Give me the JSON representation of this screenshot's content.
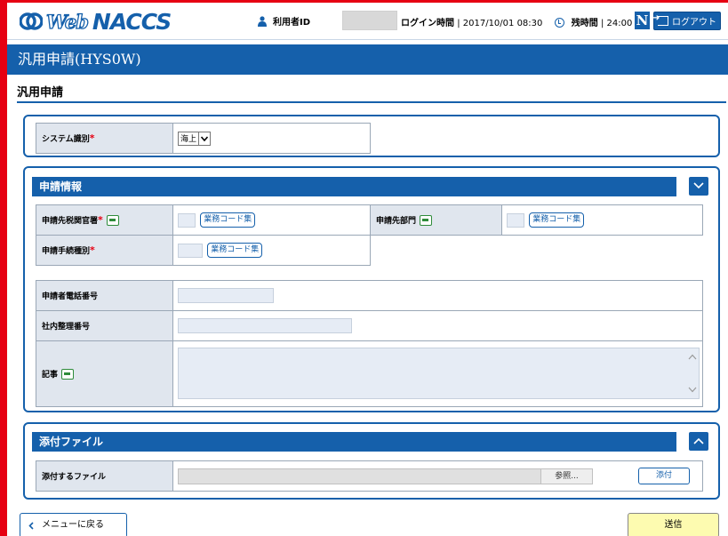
{
  "header": {
    "logo_web": "Web",
    "logo_naccs": "NACCS",
    "user_id_label": "利用者ID",
    "login_time_label": "ログイン時間",
    "login_time_value": "2017/10/01 08:30",
    "remaining_label": "残時間",
    "remaining_value": "24:00",
    "n_label": "N",
    "logout_label": "ログアウト"
  },
  "page": {
    "title": "汎用申請(HYS0W)",
    "section_title": "汎用申請"
  },
  "system_panel": {
    "system_label": "システム識別",
    "system_value": "海上"
  },
  "application_panel": {
    "heading": "申請情報",
    "customs_office_label": "申請先税関官署",
    "department_label": "申請先部門",
    "procedure_type_label": "申請手続種別",
    "code_button_label": "業務コード集",
    "phone_label": "申請者電話番号",
    "internal_number_label": "社内整理番号",
    "remarks_label": "記事"
  },
  "attachment_panel": {
    "heading": "添付ファイル",
    "file_label": "添付するファイル",
    "browse_label": "参照...",
    "attach_label": "添付"
  },
  "footer": {
    "back_label": "メニューに戻る",
    "send_label": "送信"
  },
  "required_mark": "*",
  "colors": {
    "brand_blue": "#1560ab",
    "frame_red": "#e60012",
    "required_red": "#e60012",
    "send_yellow": "#fdfbb0"
  }
}
